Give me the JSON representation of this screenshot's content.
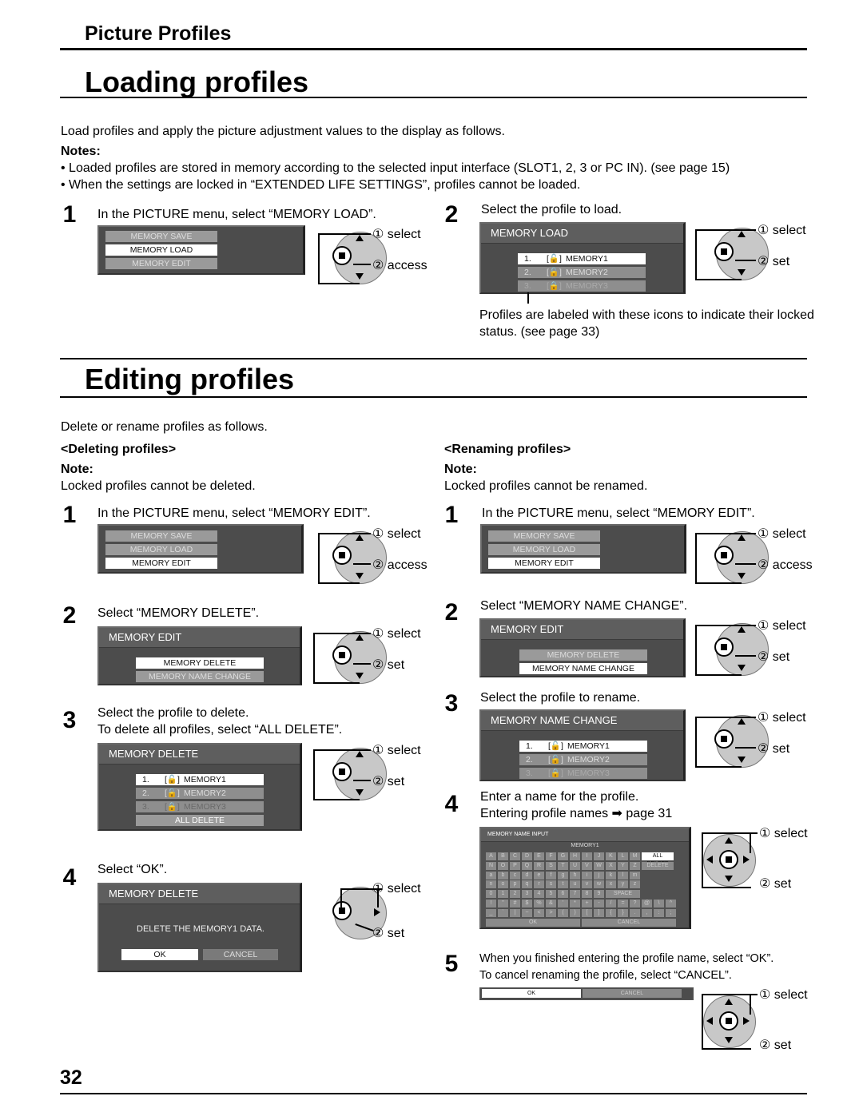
{
  "header": {
    "section": "Picture Profiles"
  },
  "loading": {
    "title": "Loading profiles",
    "intro": "Load profiles and apply the picture adjustment values to the display as follows.",
    "notes_label": "Notes:",
    "notes": [
      "• Loaded profiles are stored in memory according to the selected input interface (SLOT1, 2, 3 or PC IN). (see page 15)",
      "• When the settings are locked in “EXTENDED LIFE SETTINGS”, profiles cannot be loaded."
    ],
    "step1": {
      "num": "1",
      "text": "In the PICTURE menu, select “MEMORY LOAD”.",
      "menu": [
        "MEMORY SAVE",
        "MEMORY LOAD",
        "MEMORY EDIT"
      ],
      "selected": 1,
      "remote": {
        "label1": "① select",
        "label2": "② access"
      }
    },
    "step2": {
      "num": "2",
      "text": "Select the profile to load.",
      "osd_title": "MEMORY LOAD",
      "profiles": [
        {
          "num": "1.",
          "icon": "unlocked",
          "name": "MEMORY1"
        },
        {
          "num": "2.",
          "icon": "unlocked",
          "name": "MEMORY2"
        },
        {
          "num": "3.",
          "icon": "locked",
          "name": "MEMORY3"
        }
      ],
      "remote": {
        "label1": "① select",
        "label2": "② set"
      },
      "caption": "Profiles are labeled with these icons to indicate their locked status. (see page 33)"
    }
  },
  "editing": {
    "title": "Editing profiles",
    "intro": "Delete or rename profiles as follows.",
    "deleting": {
      "heading": "<Deleting profiles>",
      "note_label": "Note:",
      "note": "Locked profiles cannot be deleted.",
      "step1": {
        "num": "1",
        "text": "In the PICTURE menu, select “MEMORY EDIT”.",
        "menu": [
          "MEMORY SAVE",
          "MEMORY LOAD",
          "MEMORY EDIT"
        ],
        "remote": {
          "label1": "① select",
          "label2": "② access"
        }
      },
      "step2": {
        "num": "2",
        "text": "Select “MEMORY DELETE”.",
        "osd_title": "MEMORY EDIT",
        "items": [
          "MEMORY DELETE",
          "MEMORY NAME CHANGE"
        ],
        "remote": {
          "label1": "① select",
          "label2": "② set"
        }
      },
      "step3": {
        "num": "3",
        "text1": "Select the profile to delete.",
        "text2": "To delete all profiles, select “ALL DELETE”.",
        "osd_title": "MEMORY DELETE",
        "all_delete": "ALL DELETE",
        "remote": {
          "label1": "① select",
          "label2": "② set"
        }
      },
      "step4": {
        "num": "4",
        "text": "Select “OK”.",
        "osd_title": "MEMORY DELETE",
        "message": "DELETE THE MEMORY1 DATA.",
        "ok": "OK",
        "cancel": "CANCEL",
        "remote": {
          "label1": "① select",
          "label2": "② set"
        }
      }
    },
    "renaming": {
      "heading": "<Renaming profiles>",
      "note_label": "Note:",
      "note": "Locked profiles cannot be renamed.",
      "step1": {
        "num": "1",
        "text": "In the PICTURE menu, select “MEMORY EDIT”.",
        "menu": [
          "MEMORY SAVE",
          "MEMORY LOAD",
          "MEMORY EDIT"
        ],
        "remote": {
          "label1": "① select",
          "label2": "② access"
        }
      },
      "step2": {
        "num": "2",
        "text": "Select “MEMORY NAME CHANGE”.",
        "osd_title": "MEMORY EDIT",
        "items": [
          "MEMORY DELETE",
          "MEMORY NAME CHANGE"
        ],
        "remote": {
          "label1": "① select",
          "label2": "② set"
        }
      },
      "step3": {
        "num": "3",
        "text": "Select the profile to rename.",
        "osd_title": "MEMORY NAME CHANGE",
        "remote": {
          "label1": "① select",
          "label2": "② set"
        }
      },
      "step4": {
        "num": "4",
        "text1": "Enter a name for the profile.",
        "text2": "Entering profile names ➡ page 31",
        "osd_title": "MEMORY NAME INPUT",
        "current_name": "MEMORY1",
        "rows": [
          [
            "A",
            "B",
            "C",
            "D",
            "E",
            "F",
            "G",
            "H",
            "I",
            "J",
            "K",
            "L",
            "M"
          ],
          [
            "N",
            "O",
            "P",
            "Q",
            "R",
            "S",
            "T",
            "U",
            "V",
            "W",
            "X",
            "Y",
            "Z"
          ],
          [
            "a",
            "b",
            "c",
            "d",
            "e",
            "f",
            "g",
            "h",
            "i",
            "j",
            "k",
            "l",
            "m"
          ],
          [
            "n",
            "o",
            "p",
            "q",
            "r",
            "s",
            "t",
            "u",
            "v",
            "w",
            "x",
            "y",
            "z"
          ],
          [
            "0",
            "1",
            "2",
            "3",
            "4",
            "5",
            "6",
            "7",
            "8",
            "9"
          ],
          [
            "!",
            "\"",
            "#",
            "$",
            "%",
            "&",
            "'",
            "*",
            "+",
            "-",
            "/",
            "=",
            "?",
            "@",
            "\\",
            "^"
          ],
          [
            "_",
            "`",
            "|",
            "~",
            "<",
            ">",
            "(",
            ")",
            "[",
            "]",
            "{",
            "}",
            ".",
            ",",
            ":",
            ";"
          ]
        ],
        "all_delete": "ALL DELETE",
        "delete": "DELETE",
        "space": "SPACE",
        "ok": "OK",
        "cancel": "CANCEL",
        "remote": {
          "label1": "① select",
          "label2": "② set"
        }
      },
      "step5": {
        "num": "5",
        "text1": "When you finished entering the profile name, select “OK”.",
        "text2": "To cancel renaming the profile, select “CANCEL”.",
        "ok": "OK",
        "cancel": "CANCEL",
        "remote": {
          "label1": "① select",
          "label2": "② set"
        }
      }
    }
  },
  "footer": {
    "page_number": "32"
  }
}
